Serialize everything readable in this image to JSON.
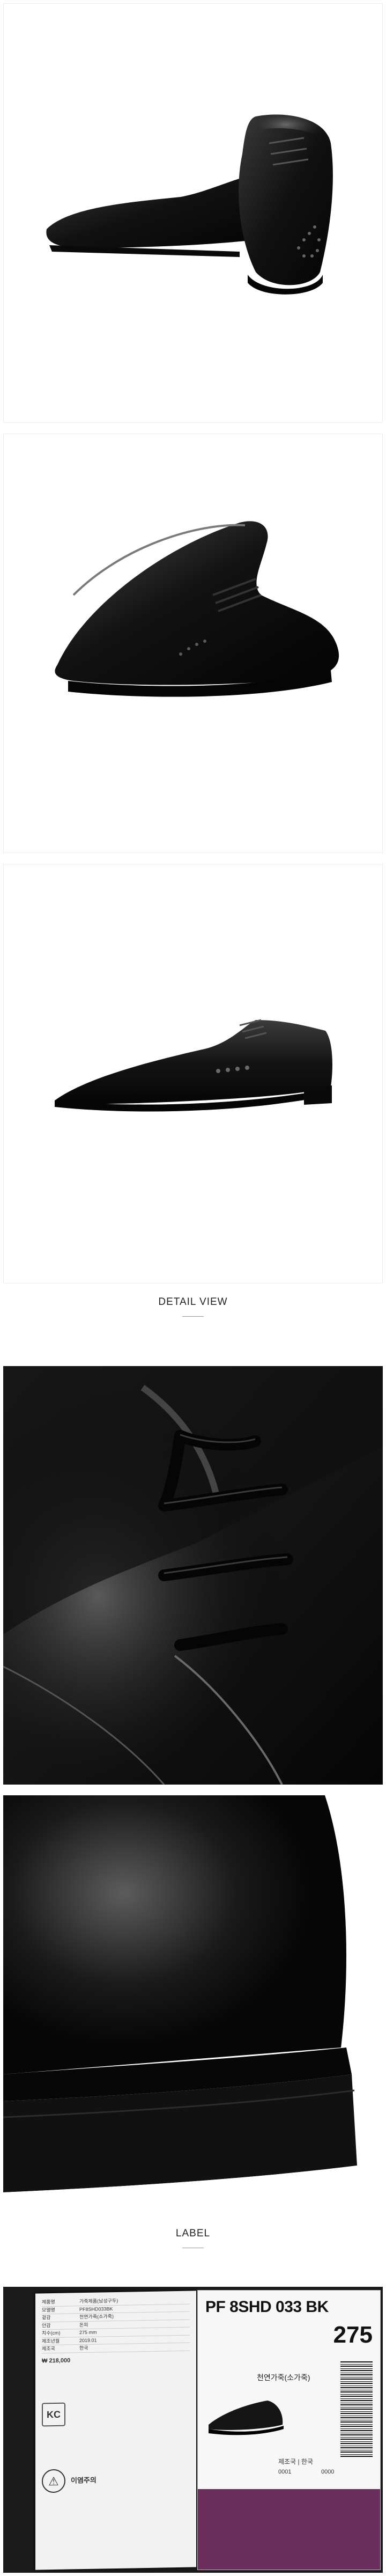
{
  "sections": {
    "detail_title": "DETAIL VIEW",
    "label_title": "LABEL"
  },
  "label_info": {
    "model_code": "PF 8SHD 033 BK",
    "size_number": "275",
    "material_line": "천연가죽(소가죽)",
    "origin_line": "제조국 | 한국",
    "stock_a": "0001",
    "stock_b": "0000",
    "tag_rows": [
      {
        "k": "제품명",
        "v": "가죽제품(남성구두)"
      },
      {
        "k": "모델명",
        "v": "PF8SHD033BK"
      },
      {
        "k": "겉감",
        "v": "천연가죽(소가죽)"
      },
      {
        "k": "안감",
        "v": "돈피"
      },
      {
        "k": "치수(cm)",
        "v": "275 mm"
      },
      {
        "k": "제조년월",
        "v": "2019.01"
      },
      {
        "k": "제조국",
        "v": "한국"
      }
    ],
    "price_line": "₩ 218,000",
    "caution_title": "이염주의"
  },
  "colors": {
    "leather": "#141414",
    "background": "#ffffff",
    "label_purple": "#6b2d5c"
  },
  "icons": [
    "shoe-photo-icon",
    "barcode-icon",
    "kc-mark-icon",
    "caution-icon"
  ]
}
